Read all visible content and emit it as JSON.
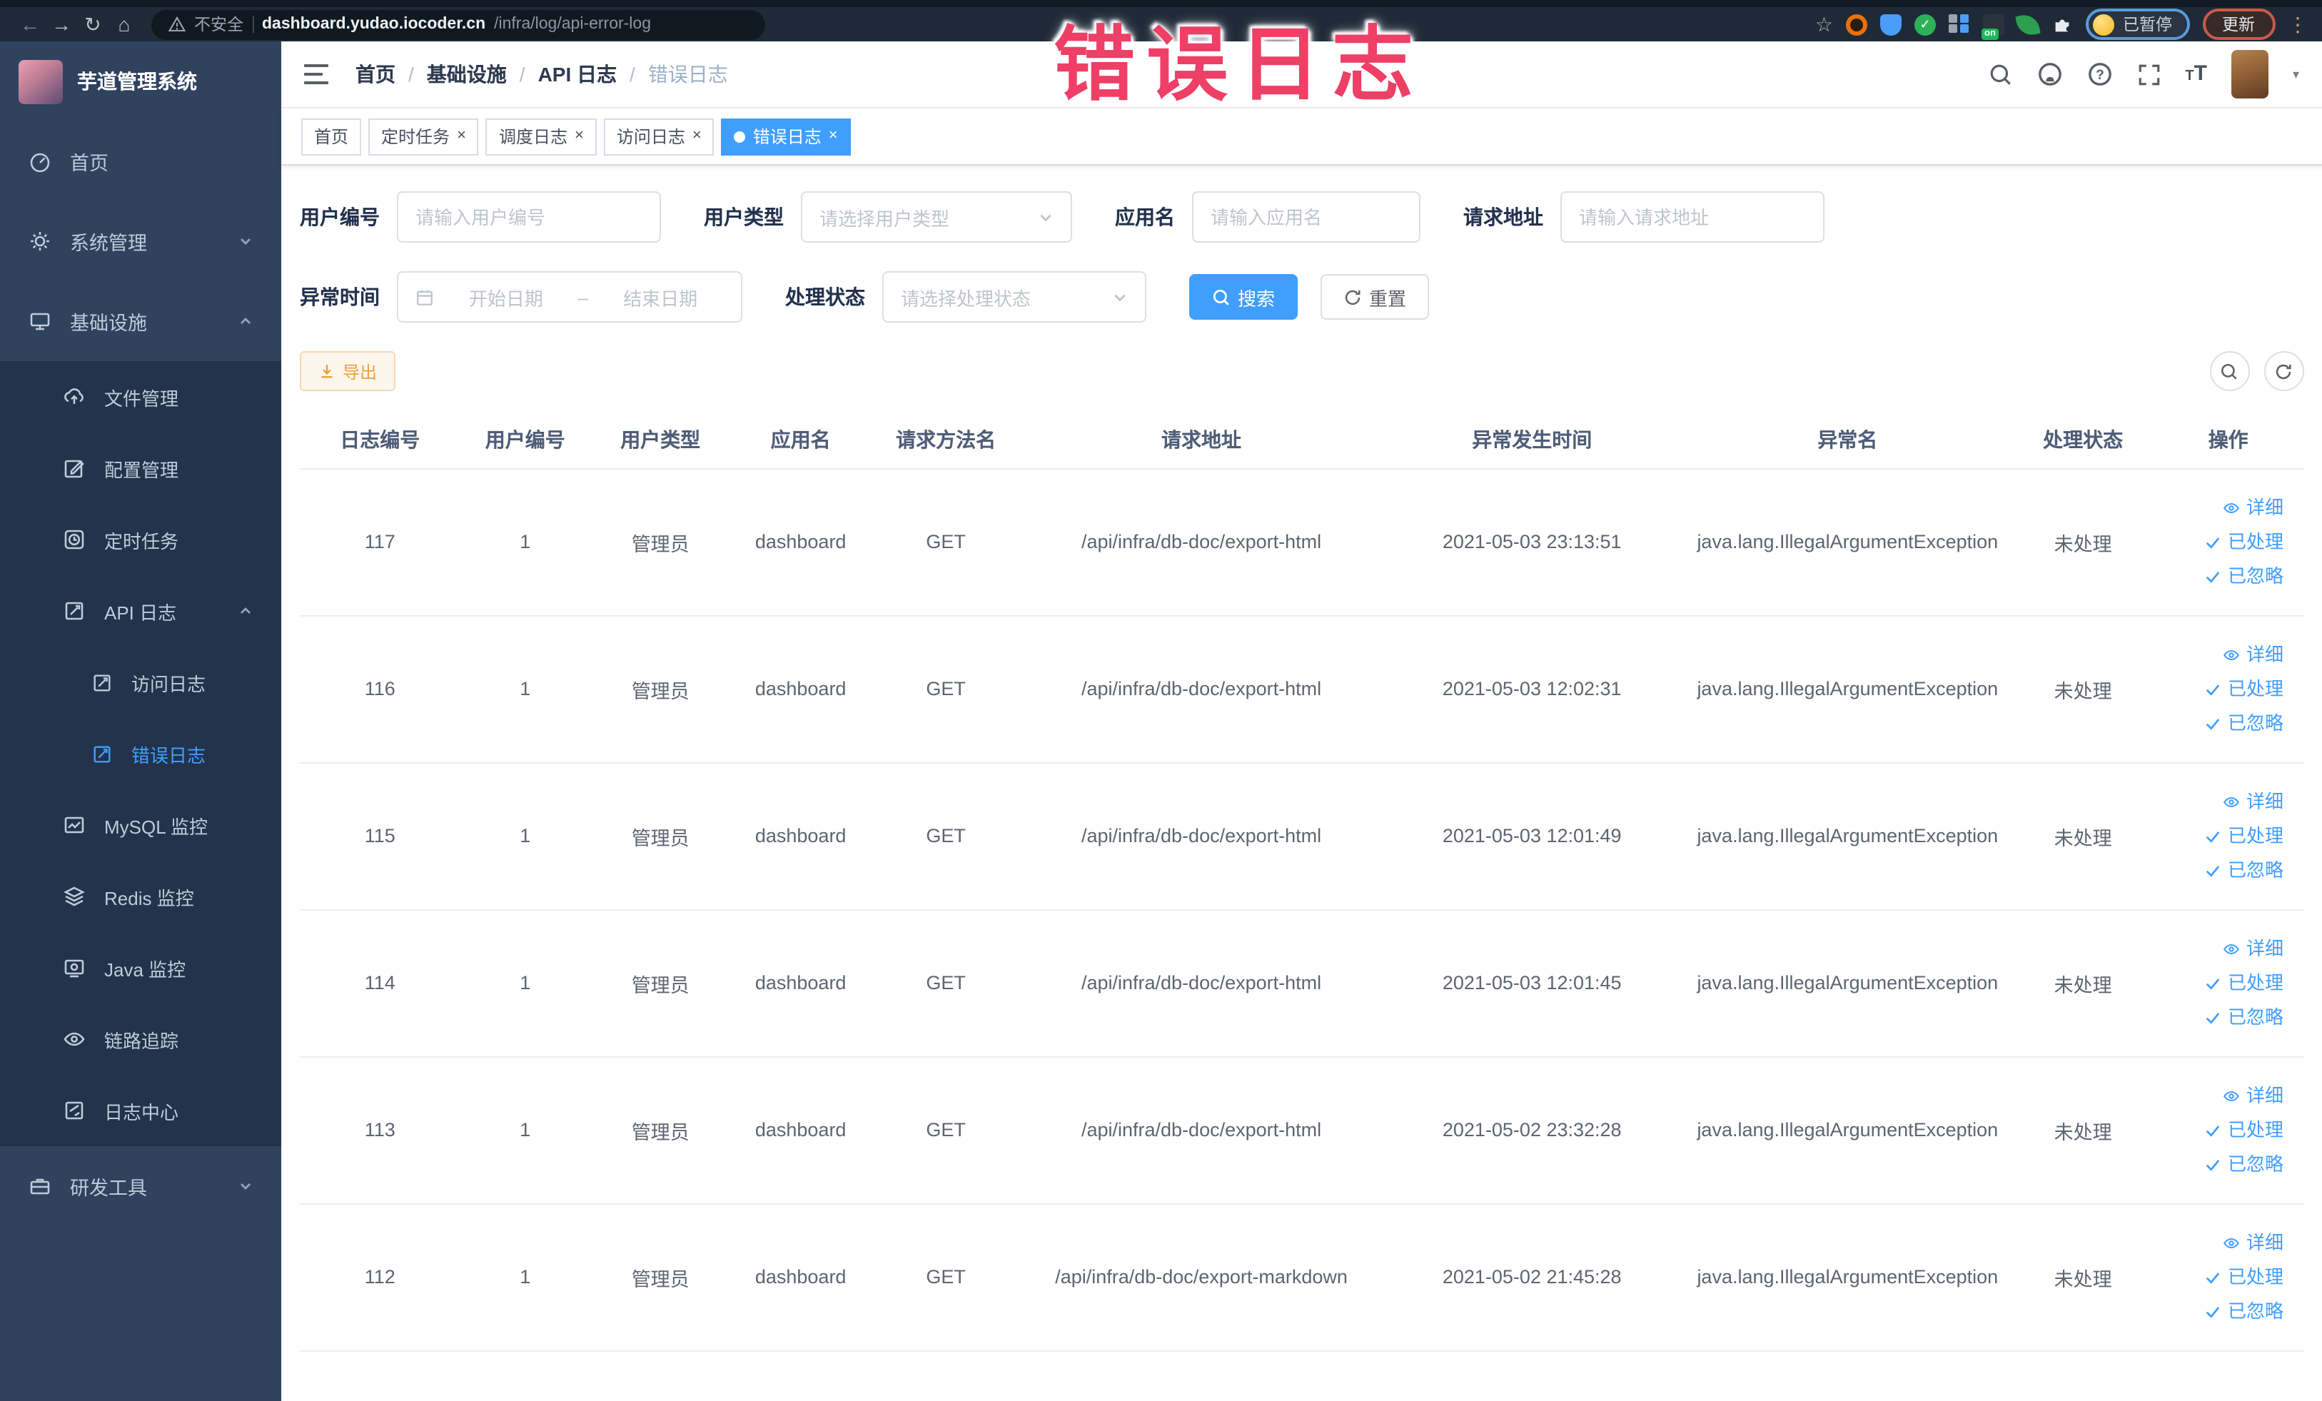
{
  "browser": {
    "security_label": "不安全",
    "url_host": "dashboard.yudao.iocoder.cn",
    "url_path": "/infra/log/api-error-log",
    "paused_label": "已暂停",
    "update_label": "更新",
    "on_badge": "on",
    "menu_glyph": "⋮"
  },
  "watermark": {
    "text": "错误日志",
    "color": "#ee3f67"
  },
  "sidebar": {
    "title": "芋道管理系统",
    "items": [
      {
        "label": "首页"
      },
      {
        "label": "系统管理"
      },
      {
        "label": "基础设施"
      },
      {
        "label": "文件管理"
      },
      {
        "label": "配置管理"
      },
      {
        "label": "定时任务"
      },
      {
        "label": "API 日志"
      },
      {
        "label": "访问日志"
      },
      {
        "label": "错误日志",
        "active": true
      },
      {
        "label": "MySQL 监控"
      },
      {
        "label": "Redis 监控"
      },
      {
        "label": "Java 监控"
      },
      {
        "label": "链路追踪"
      },
      {
        "label": "日志中心"
      },
      {
        "label": "研发工具"
      }
    ]
  },
  "header": {
    "breadcrumb": [
      "首页",
      "基础设施",
      "API 日志",
      "错误日志"
    ],
    "separator": "/"
  },
  "ui": {
    "close_glyph": "×",
    "caret_glyph": "▾"
  },
  "tabs": [
    {
      "label": "首页"
    },
    {
      "label": "定时任务"
    },
    {
      "label": "调度日志"
    },
    {
      "label": "访问日志"
    },
    {
      "label": "错误日志",
      "active": true
    }
  ],
  "filters": {
    "user_id": {
      "label": "用户编号",
      "placeholder": "请输入用户编号"
    },
    "user_type": {
      "label": "用户类型",
      "placeholder": "请选择用户类型"
    },
    "app_name": {
      "label": "应用名",
      "placeholder": "请输入应用名"
    },
    "request_url": {
      "label": "请求地址",
      "placeholder": "请输入请求地址"
    },
    "exception_time": {
      "label": "异常时间",
      "start_placeholder": "开始日期",
      "separator": "–",
      "end_placeholder": "结束日期"
    },
    "process_status": {
      "label": "处理状态",
      "placeholder": "请选择处理状态"
    },
    "search_label": "搜索",
    "reset_label": "重置"
  },
  "toolbar": {
    "export_label": "导出"
  },
  "table": {
    "columns": [
      "日志编号",
      "用户编号",
      "用户类型",
      "应用名",
      "请求方法名",
      "请求地址",
      "异常发生时间",
      "异常名",
      "处理状态",
      "操作"
    ],
    "row_actions": [
      "详细",
      "已处理",
      "已忽略"
    ],
    "rows": [
      {
        "id": "117",
        "user_id": "1",
        "user_type": "管理员",
        "app_name": "dashboard",
        "method": "GET",
        "url": "/api/infra/db-doc/export-html",
        "time": "2021-05-03 23:13:51",
        "exception": "java.lang.IllegalArgumentException",
        "status": "未处理"
      },
      {
        "id": "116",
        "user_id": "1",
        "user_type": "管理员",
        "app_name": "dashboard",
        "method": "GET",
        "url": "/api/infra/db-doc/export-html",
        "time": "2021-05-03 12:02:31",
        "exception": "java.lang.IllegalArgumentException",
        "status": "未处理"
      },
      {
        "id": "115",
        "user_id": "1",
        "user_type": "管理员",
        "app_name": "dashboard",
        "method": "GET",
        "url": "/api/infra/db-doc/export-html",
        "time": "2021-05-03 12:01:49",
        "exception": "java.lang.IllegalArgumentException",
        "status": "未处理"
      },
      {
        "id": "114",
        "user_id": "1",
        "user_type": "管理员",
        "app_name": "dashboard",
        "method": "GET",
        "url": "/api/infra/db-doc/export-html",
        "time": "2021-05-03 12:01:45",
        "exception": "java.lang.IllegalArgumentException",
        "status": "未处理"
      },
      {
        "id": "113",
        "user_id": "1",
        "user_type": "管理员",
        "app_name": "dashboard",
        "method": "GET",
        "url": "/api/infra/db-doc/export-html",
        "time": "2021-05-02 23:32:28",
        "exception": "java.lang.IllegalArgumentException",
        "status": "未处理"
      },
      {
        "id": "112",
        "user_id": "1",
        "user_type": "管理员",
        "app_name": "dashboard",
        "method": "GET",
        "url": "/api/infra/db-doc/export-markdown",
        "time": "2021-05-02 21:45:28",
        "exception": "java.lang.IllegalArgumentException",
        "status": "未处理"
      }
    ]
  },
  "colors": {
    "accent": "#409eff",
    "warning": "#e6a23c",
    "watermark": "#ee3f67"
  }
}
